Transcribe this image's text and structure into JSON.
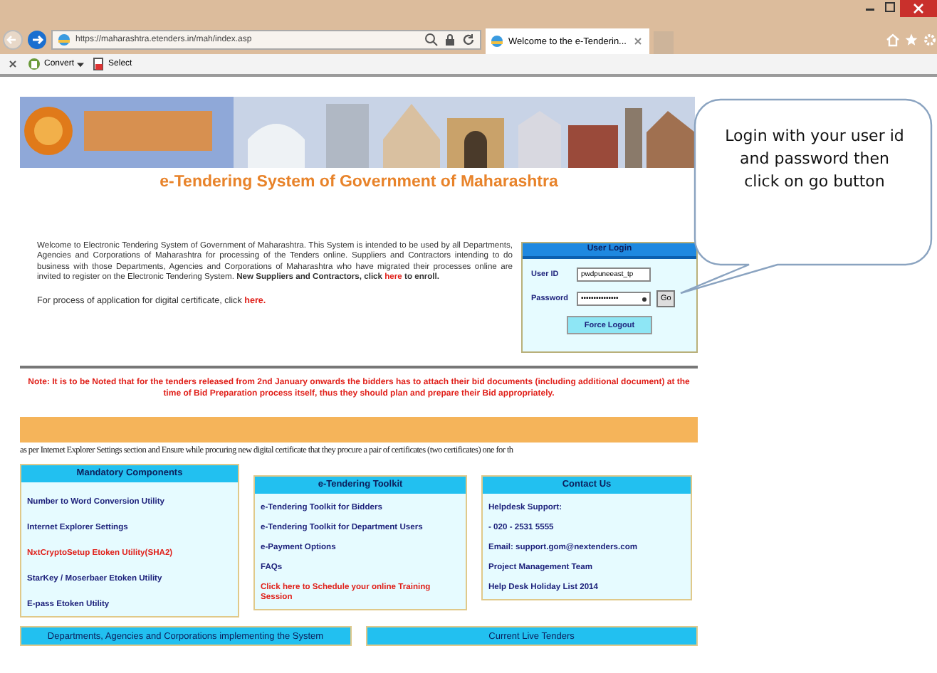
{
  "browser": {
    "url": "https://maharashtra.etenders.in/mah/index.asp",
    "tab_title": "Welcome to the e-Tenderin...",
    "toolbar": [
      "Convert",
      "Select"
    ]
  },
  "page": {
    "title": "e-Tendering System of Government of Maharashtra",
    "welcome": {
      "text_before": "Welcome to Electronic Tendering System of Government of Maharashtra. This System is intended to be used by all Departments, Agencies and Corporations of Maharashtra for processing of the Tenders online. Suppliers and Contractors intending to do business with those Departments, Agencies and Corporations of Maharashtra who have migrated their processes online are invited to register on the Electronic Tendering System. **New Suppliers and Contractors, click** ",
      "link": "here",
      "text_after": " **to enroll.**"
    },
    "certificate": {
      "text_before": "For process of application for digital certificate, click ",
      "link": "here."
    },
    "login": {
      "title": "User Login",
      "fields": [
        {
          "label": "User ID",
          "value": "pwdpuneeast_tp"
        },
        {
          "label": "Password",
          "value": "•••••••••••••••"
        }
      ],
      "go": "Go",
      "force_logout": "Force Logout"
    },
    "note": "Note: It is to be Noted that for the tenders released from 2nd January onwards the bidders has to attach their bid documents (including additional document) at the time of Bid Preparation process itself, thus they should plan and prepare their Bid appropriately.",
    "marquee": "as per Internet Explorer Settings section and Ensure while procuring new digital certificate that they procure a pair of certificates (two certificates) one for th",
    "panels": [
      {
        "title": "Mandatory Components",
        "items": [
          {
            "text": "Number to Word Conversion Utility",
            "color": "#1b1f7a"
          },
          {
            "text": "Internet Explorer Settings",
            "color": "#1b1f7a"
          },
          {
            "text": "NxtCryptoSetup Etoken Utility(SHA2)",
            "color": "#e0201a"
          },
          {
            "text": "StarKey / Moserbaer Etoken Utility",
            "color": "#1b1f7a"
          },
          {
            "text": "E-pass Etoken Utility",
            "color": "#1b1f7a"
          }
        ]
      },
      {
        "title": "e-Tendering Toolkit",
        "items": [
          {
            "text": "e-Tendering Toolkit for Bidders",
            "color": "#1b1f7a"
          },
          {
            "text": "e-Tendering Toolkit for Department Users",
            "color": "#1b1f7a"
          },
          {
            "text": "e-Payment Options",
            "color": "#1b1f7a"
          },
          {
            "text": "FAQs",
            "color": "#1b1f7a"
          },
          {
            "text": "Click here to Schedule your online Training Session",
            "color": "#e0201a"
          }
        ]
      },
      {
        "title": "Contact Us",
        "items": [
          {
            "text": "Helpdesk Support:",
            "color": "#1b1f7a"
          },
          {
            "text": "- 020 - 2531 5555",
            "color": "#1b1f7a"
          },
          {
            "text": "Email: support.gom@nextenders.com",
            "color": "#1b1f7a"
          },
          {
            "text": "Project Management Team",
            "color": "#1b1f7a"
          },
          {
            "text": "Help Desk Holiday List 2014",
            "color": "#1b1f7a"
          }
        ]
      }
    ],
    "bottom_headers": [
      "Departments, Agencies and Corporations implementing the System",
      "Current Live Tenders"
    ]
  },
  "callout": "Login with your user id and password then click on go button"
}
